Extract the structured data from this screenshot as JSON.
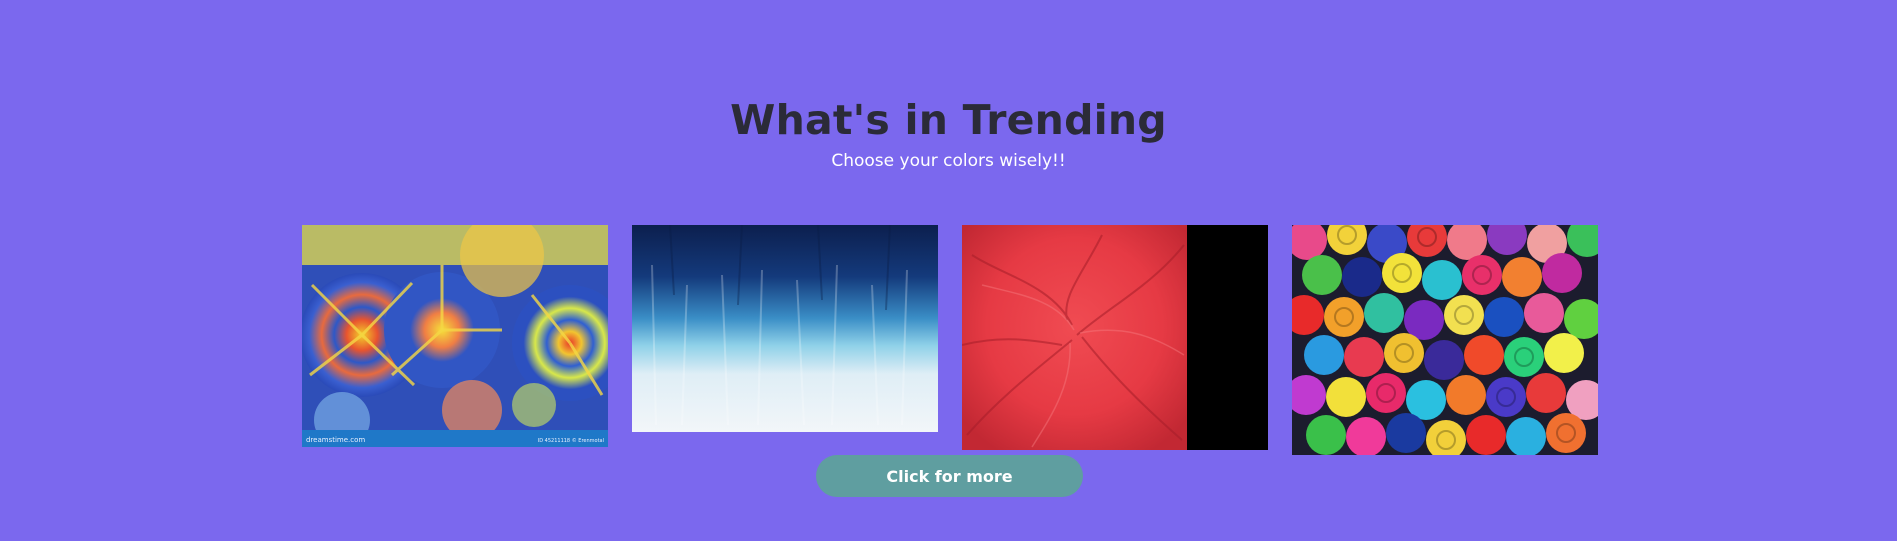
{
  "trending": {
    "title": "What's in Trending",
    "subtitle": "Choose your colors wisely!!",
    "button_label": "Click for more",
    "cards": [
      {
        "name": "tie-dye-fabric",
        "watermark_left": "dreamstime.com",
        "watermark_right": "ID 45211118 © Erenmotal"
      },
      {
        "name": "blue-ombre-fabric"
      },
      {
        "name": "red-silk-fabric"
      },
      {
        "name": "rolled-colorful-fabrics"
      }
    ]
  },
  "colors": {
    "background": "#7b68ee",
    "title": "#2b2b38",
    "subtitle": "#ffffff",
    "button_bg": "#5f9ea0",
    "button_text": "#ffffff"
  }
}
